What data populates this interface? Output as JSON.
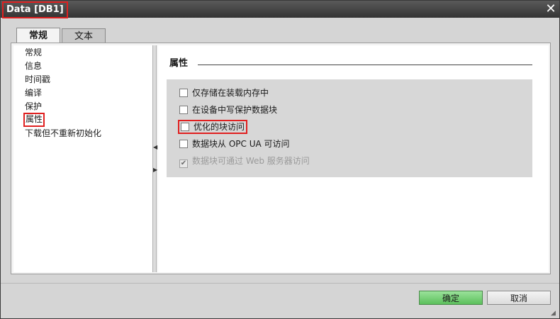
{
  "window": {
    "title": "Data [DB1]"
  },
  "tabs": [
    {
      "label": "常规",
      "active": true
    },
    {
      "label": "文本",
      "active": false
    }
  ],
  "nav": {
    "items": [
      {
        "label": "常规",
        "selected": false
      },
      {
        "label": "信息",
        "selected": false
      },
      {
        "label": "时间戳",
        "selected": false
      },
      {
        "label": "编译",
        "selected": false
      },
      {
        "label": "保护",
        "selected": false
      },
      {
        "label": "属性",
        "selected": true
      },
      {
        "label": "下载但不重新初始化",
        "selected": false
      }
    ]
  },
  "panel": {
    "title": "属性",
    "options": [
      {
        "label": "仅存储在装载内存中",
        "checked": false,
        "enabled": true
      },
      {
        "label": "在设备中写保护数据块",
        "checked": false,
        "enabled": true
      },
      {
        "label": "优化的块访问",
        "checked": false,
        "enabled": true
      },
      {
        "label": "数据块从 OPC UA 可访问",
        "checked": false,
        "enabled": true
      },
      {
        "label": "数据块可通过 Web 服务器访问",
        "checked": true,
        "enabled": false
      }
    ]
  },
  "buttons": {
    "ok": "确定",
    "cancel": "取消"
  },
  "colors": {
    "highlight": "#e02020",
    "ok_button": "#5cc05c"
  }
}
